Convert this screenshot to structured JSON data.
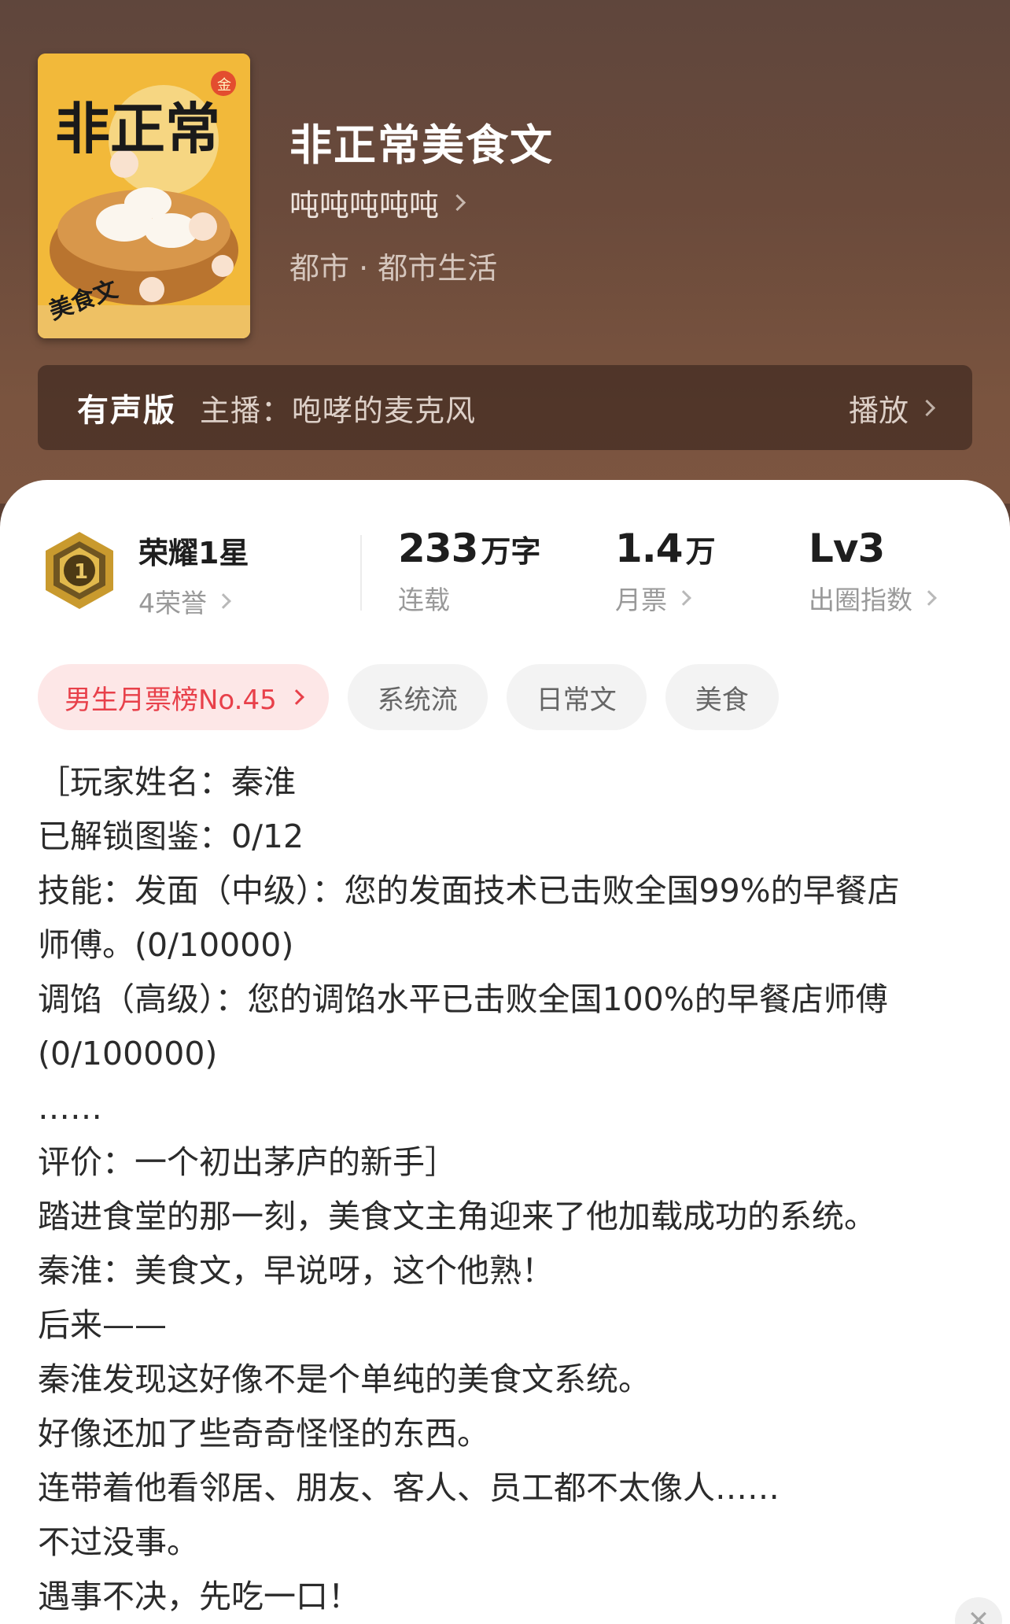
{
  "book": {
    "title": "非正常美食文",
    "author": "吨吨吨吨吨",
    "category": "都市 · 都市生活",
    "cover_title": "非正常",
    "cover_subtitle": "美食文",
    "cover_badge": "金"
  },
  "audio": {
    "tag": "有声版",
    "anchor": "主播：咆哮的麦克风",
    "play_label": "播放"
  },
  "stats": {
    "honor_title": "荣耀1星",
    "honor_sub": "4荣誉",
    "honor_level": "1",
    "words_value": "233",
    "words_unit": "万字",
    "words_label": "连载",
    "tickets_value": "1.4",
    "tickets_unit": "万",
    "tickets_label": "月票",
    "influence_value": "Lv3",
    "influence_label": "出圈指数"
  },
  "tags": {
    "rank": "男生月票榜No.45",
    "items": [
      "系统流",
      "日常文",
      "美食"
    ]
  },
  "synopsis": [
    "［玩家姓名：秦淮",
    "已解锁图鉴：0/12",
    "技能：发面（中级）：您的发面技术已击败全国99%的早餐店",
    "师傅。(0/10000)",
    "调馅（高级）：您的调馅水平已击败全国100%的早餐店师傅",
    "(0/100000)",
    "……",
    "评价：一个初出茅庐的新手］",
    "踏进食堂的那一刻，美食文主角迎来了他加载成功的系统。",
    "秦淮：美食文，早说呀，这个他熟！",
    "后来——",
    "秦淮发现这好像不是个单纯的美食文系统。",
    "好像还加了些奇奇怪怪的东西。",
    "连带着他看邻居、朋友、客人、员工都不太像人……",
    "不过没事。",
    "遇事不决，先吃一口！"
  ],
  "colors": {
    "header_bg": "#6a4a3b",
    "rank_tag_text": "#e8404a",
    "rank_tag_bg": "#fde7e7",
    "cover_bg": "#f0b82e",
    "badge_gold": "#c99a2e"
  },
  "icons": {
    "chevron": "chevron-right-icon",
    "honor": "honor-badge-icon",
    "close": "close-icon"
  }
}
